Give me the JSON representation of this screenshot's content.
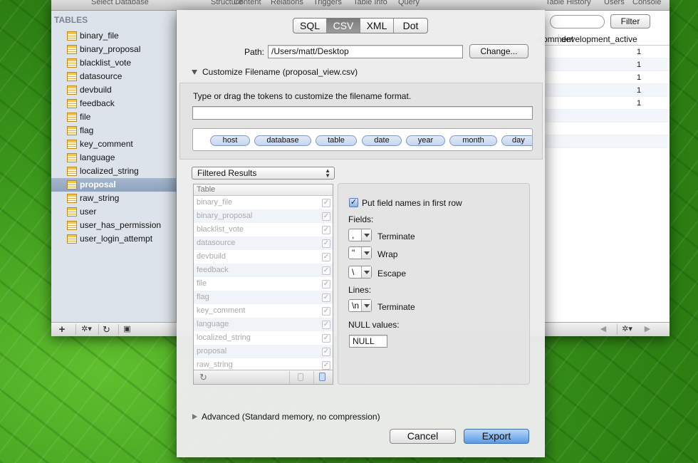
{
  "toolbar": {
    "items": [
      "Select Database",
      "Structure",
      "Content",
      "Relations",
      "Triggers",
      "Table Info",
      "Query",
      "Table History",
      "Users",
      "Console"
    ]
  },
  "sidebar": {
    "header": "TABLES",
    "items": [
      "binary_file",
      "binary_proposal",
      "blacklist_vote",
      "datasource",
      "devbuild",
      "feedback",
      "file",
      "flag",
      "key_comment",
      "language",
      "localized_string",
      "proposal",
      "raw_string",
      "user",
      "user_has_permission",
      "user_login_attempt"
    ],
    "selected": "proposal"
  },
  "bottom_bar": {
    "add": "+",
    "gear": "✲▾",
    "refresh": "↻",
    "info": "▣",
    "prev": "◀",
    "next": "▶"
  },
  "content": {
    "filter_button": "Filter",
    "columns": [
      "comment",
      "development_active"
    ],
    "rows": [
      "1",
      "1",
      "1",
      "1",
      "1"
    ]
  },
  "sheet": {
    "formats": [
      "SQL",
      "CSV",
      "XML",
      "Dot"
    ],
    "selected_format": "CSV",
    "path_label": "Path:",
    "path_value": "/Users/matt/Desktop",
    "change_button": "Change...",
    "customize_label": "Customize Filename (proposal_view.csv)",
    "token_hint": "Type or drag the tokens to customize the filename format.",
    "tokens": [
      "host",
      "database",
      "table",
      "date",
      "year",
      "month",
      "day"
    ],
    "results_popup": "Filtered Results",
    "table_header": "Table",
    "tables": [
      "binary_file",
      "binary_proposal",
      "blacklist_vote",
      "datasource",
      "devbuild",
      "feedback",
      "file",
      "flag",
      "key_comment",
      "language",
      "localized_string",
      "proposal",
      "raw_string"
    ],
    "put_field_names": "Put field names in first row",
    "fields_label": "Fields:",
    "lines_label": "Lines:",
    "null_label": "NULL values:",
    "null_value": "NULL",
    "terminate_label": "Terminate",
    "wrap_label": "Wrap",
    "escape_label": "Escape",
    "field_terminate": ",",
    "field_wrap": "\"",
    "field_escape": "\\",
    "line_terminate": "\\n",
    "advanced_label": "Advanced (Standard memory, no compression)",
    "cancel_button": "Cancel",
    "export_button": "Export"
  }
}
